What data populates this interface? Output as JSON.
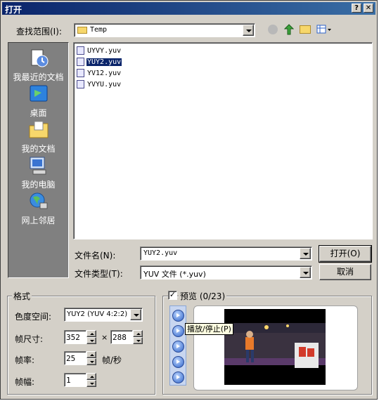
{
  "window": {
    "title": "打开"
  },
  "lookin": {
    "label": "查找范围(I):",
    "value": "Temp"
  },
  "places": [
    {
      "label": "我最近的文档"
    },
    {
      "label": "桌面"
    },
    {
      "label": "我的文档"
    },
    {
      "label": "我的电脑"
    },
    {
      "label": "网上邻居"
    }
  ],
  "files": [
    {
      "name": "UYVY.yuv"
    },
    {
      "name": "YUY2.yuv",
      "selected": true
    },
    {
      "name": "YV12.yuv"
    },
    {
      "name": "YVYU.yuv"
    }
  ],
  "filename": {
    "label": "文件名(N):",
    "value": "YUY2.yuv"
  },
  "filetype": {
    "label": "文件类型(T):",
    "value": "YUV 文件 (*.yuv)"
  },
  "buttons": {
    "open": "打开(O)",
    "cancel": "取消"
  },
  "format": {
    "group_label": "格式",
    "colorspace_label": "色度空间:",
    "colorspace_value": "YUY2 (YUV 4:2:2)",
    "size_label": "帧尺寸:",
    "width": "352",
    "times": "×",
    "height": "288",
    "rate_label": "帧率:",
    "rate": "25",
    "rate_unit": "帧/秒",
    "frames_label": "帧幅:",
    "frames": "1"
  },
  "preview": {
    "label": "预览 (0/23)",
    "checked": true,
    "tooltip": "播放/停止(P)"
  },
  "colors": {
    "titlebar": "#0a246a",
    "face": "#d4d0c8",
    "selection": "#0a246a"
  }
}
